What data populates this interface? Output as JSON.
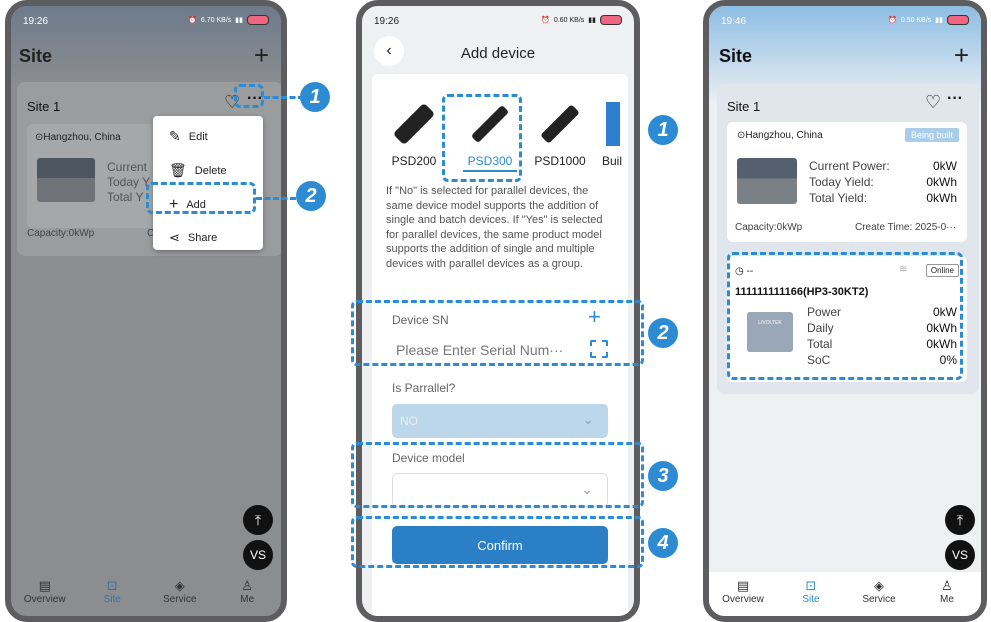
{
  "p1": {
    "time": "19:26",
    "net": "6.70 KB/s",
    "title": "Site",
    "plus": "+",
    "site": "Site 1",
    "loc": "Hangzhou, China",
    "cur": "Current",
    "today": "Today Y",
    "total": "Total Y",
    "cap": "Capacity:0kWp",
    "capc": "C",
    "menu": [
      "Edit",
      "Delete",
      "Add",
      "Share"
    ],
    "badges": [
      "1",
      "2"
    ]
  },
  "p2": {
    "time": "19:26",
    "net": "0.60 KB/s",
    "title": "Add device",
    "devices": [
      "PSD200",
      "PSD300",
      "PSD1000",
      "Buil"
    ],
    "desc": "If \"No\" is selected for parallel devices, the same device model supports the addition of single and batch devices. If \"Yes\" is selected for parallel devices, the same product model supports the addition of single and multiple devices with parallel devices as a group.",
    "sn_label": "Device SN",
    "sn_plus": "+",
    "sn_placeholder": "Please Enter Serial Num···",
    "parallel_label": "Is Parrallel?",
    "parallel_value": "NO",
    "model_label": "Device model",
    "model_value": "",
    "confirm": "Confirm",
    "badges": [
      "1",
      "2",
      "3",
      "4"
    ]
  },
  "p3": {
    "time": "19:46",
    "net": "0.50 KB/s",
    "title": "Site",
    "plus": "+",
    "site": "Site 1",
    "loc": "Hangzhou, China",
    "status": "Being built",
    "stats": [
      {
        "k": "Current Power:",
        "v": "0kW"
      },
      {
        "k": "Today Yield:",
        "v": "0kWh"
      },
      {
        "k": "Total Yield:",
        "v": "0kWh"
      }
    ],
    "cap": "Capacity:0kWp",
    "create": "Create Time: 2025-0···",
    "dev_time": "--",
    "online": "Online",
    "dev_name": "111111111166(HP3-30KT2)",
    "dev_brand": "LIVOLTEK",
    "dev_stats": [
      {
        "k": "Power",
        "v": "0kW"
      },
      {
        "k": "Daily",
        "v": "0kWh"
      },
      {
        "k": "Total",
        "v": "0kWh"
      },
      {
        "k": "SoC",
        "v": "0%"
      }
    ]
  },
  "tabs": [
    "Overview",
    "Site",
    "Service",
    "Me"
  ],
  "fab_vs": "VS",
  "colors": {
    "accent": "#2c8bd3",
    "button": "#2b7fc7",
    "select_bg": "#bcd6ea",
    "dim_overlay": "#8f9092"
  }
}
